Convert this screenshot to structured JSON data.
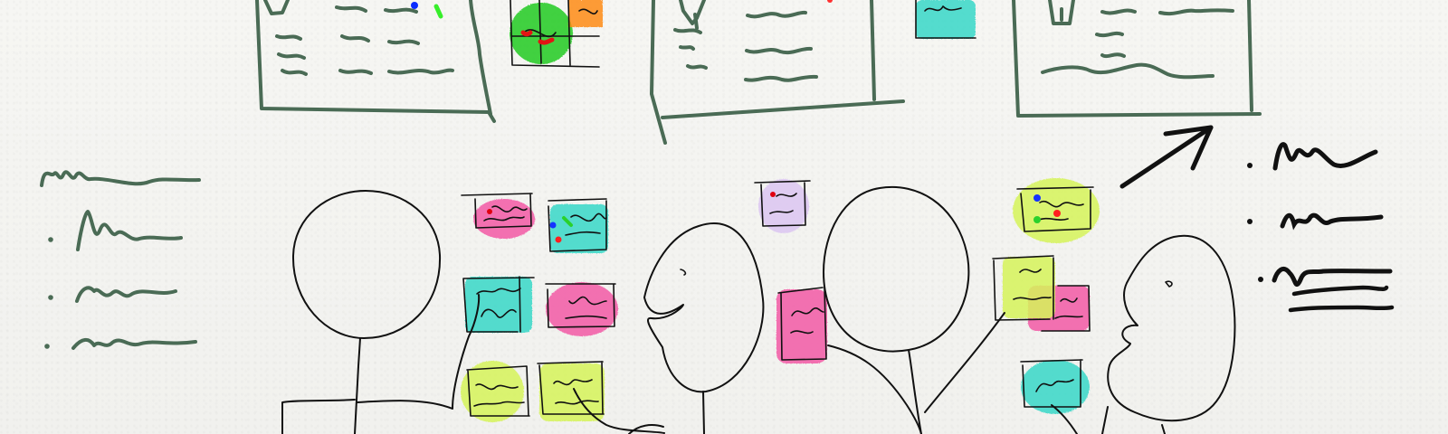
{
  "scene": {
    "sticky_colors": {
      "pink": "#f35aa6",
      "teal": "#39d8c8",
      "lime": "#d6f45a",
      "lavender": "#dcc6f2",
      "green": "#2bc431",
      "orange": "#ff8c14"
    },
    "ink_colors": {
      "board": "#4a6b55",
      "figure": "#111111"
    },
    "elements": {
      "boards": 3,
      "people": 4,
      "left_note_lines": 4,
      "right_note_lines": 3
    }
  }
}
